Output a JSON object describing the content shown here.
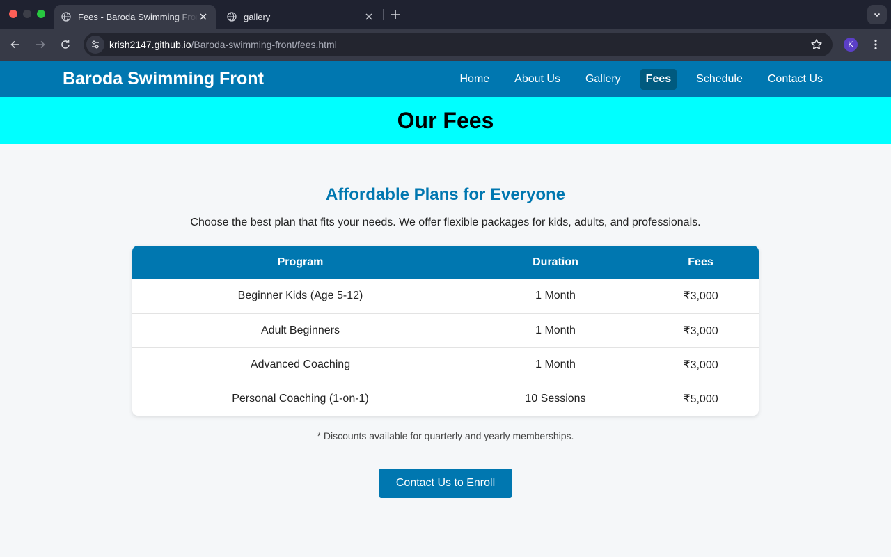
{
  "browser": {
    "tabs": [
      {
        "title": "Fees - Baroda Swimming Front",
        "active": true
      },
      {
        "title": "gallery",
        "active": false
      }
    ],
    "url_host": "krish2147.github.io",
    "url_path": "/Baroda-swimming-front/fees.html",
    "profile_initial": "K"
  },
  "header": {
    "brand": "Baroda Swimming Front",
    "nav": [
      {
        "label": "Home",
        "active": false
      },
      {
        "label": "About Us",
        "active": false
      },
      {
        "label": "Gallery",
        "active": false
      },
      {
        "label": "Fees",
        "active": true
      },
      {
        "label": "Schedule",
        "active": false
      },
      {
        "label": "Contact Us",
        "active": false
      }
    ]
  },
  "hero": {
    "title": "Our Fees"
  },
  "main": {
    "section_title": "Affordable Plans for Everyone",
    "intro": "Choose the best plan that fits your needs. We offer flexible packages for kids, adults, and professionals.",
    "table": {
      "headers": [
        "Program",
        "Duration",
        "Fees"
      ],
      "rows": [
        [
          "Beginner Kids (Age 5-12)",
          "1 Month",
          "₹3,000"
        ],
        [
          "Adult Beginners",
          "1 Month",
          "₹3,000"
        ],
        [
          "Advanced Coaching",
          "1 Month",
          "₹3,000"
        ],
        [
          "Personal Coaching (1-on-1)",
          "10 Sessions",
          "₹5,000"
        ]
      ]
    },
    "note": "* Discounts available for quarterly and yearly memberships.",
    "enroll_label": "Contact Us to Enroll"
  },
  "colors": {
    "brand_blue": "#0077b0",
    "hero_cyan": "#00ffff",
    "nav_active": "#005a7f",
    "page_bg": "#f5f7f9"
  }
}
